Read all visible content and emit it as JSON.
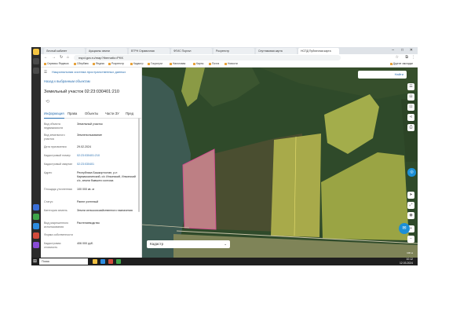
{
  "browser": {
    "tabs": [
      "Личный кабинет",
      "Аукционы земли",
      "ЕГРН Справочная",
      "ФГИС Портал",
      "Росреестр",
      "Спутниковая карта",
      "НСПД Публичная карта"
    ],
    "url": "nspd.gov.ru/map?thematic=PKK",
    "bookmarks": [
      "Сервисы Яндекса",
      "Сбербанк",
      "Яндекс",
      "Росреестр",
      "Кадастр",
      "Госуслуги",
      "Налоговая",
      "Карты",
      "Почта",
      "Новости",
      "Другие закладки"
    ]
  },
  "panel": {
    "header": "Национальная система пространственных данных",
    "back_link": "Назад к выбранным объектам",
    "title": "Земельный участок 02:23:030401:210",
    "tabs": [
      "Информация",
      "Права",
      "Объекты",
      "Части ЗУ",
      "Пред"
    ],
    "rows": [
      {
        "label": "Вид объекта недвижимости",
        "value": "Земельный участок"
      },
      {
        "label": "Вид земельного участка",
        "value": "Землепользование"
      },
      {
        "label": "Дата присвоения",
        "value": "29.02.2024"
      },
      {
        "label": "Кадастровый номер",
        "value": "02:23:030401:210"
      },
      {
        "label": "Кадастровый квартал",
        "value": "02:23:030401"
      },
      {
        "label": "Адрес",
        "value": "Республика Башкортостан, р-н Кармаскалинский, с/с Ильинский, Ильинский с/с, земли бывшего колхоза"
      },
      {
        "label": "Площадь уточненная",
        "value": "100 000 кв. м"
      },
      {
        "label": "Статус",
        "value": "Ранее учтенный"
      },
      {
        "label": "Категория земель",
        "value": "Земли сельскохозяйственного назначения"
      },
      {
        "label": "Вид разрешенного использования",
        "value": "Растениеводство"
      },
      {
        "label": "Форма собственности",
        "value": ""
      },
      {
        "label": "Кадастровая стоимость",
        "value": "406 000 руб."
      }
    ]
  },
  "map": {
    "search_label": "Найти",
    "layer": "Кадастр",
    "scale": "100 м"
  },
  "taskbar": {
    "search_placeholder": "Поиск",
    "time": "10:12",
    "date": "12.03.2024"
  }
}
